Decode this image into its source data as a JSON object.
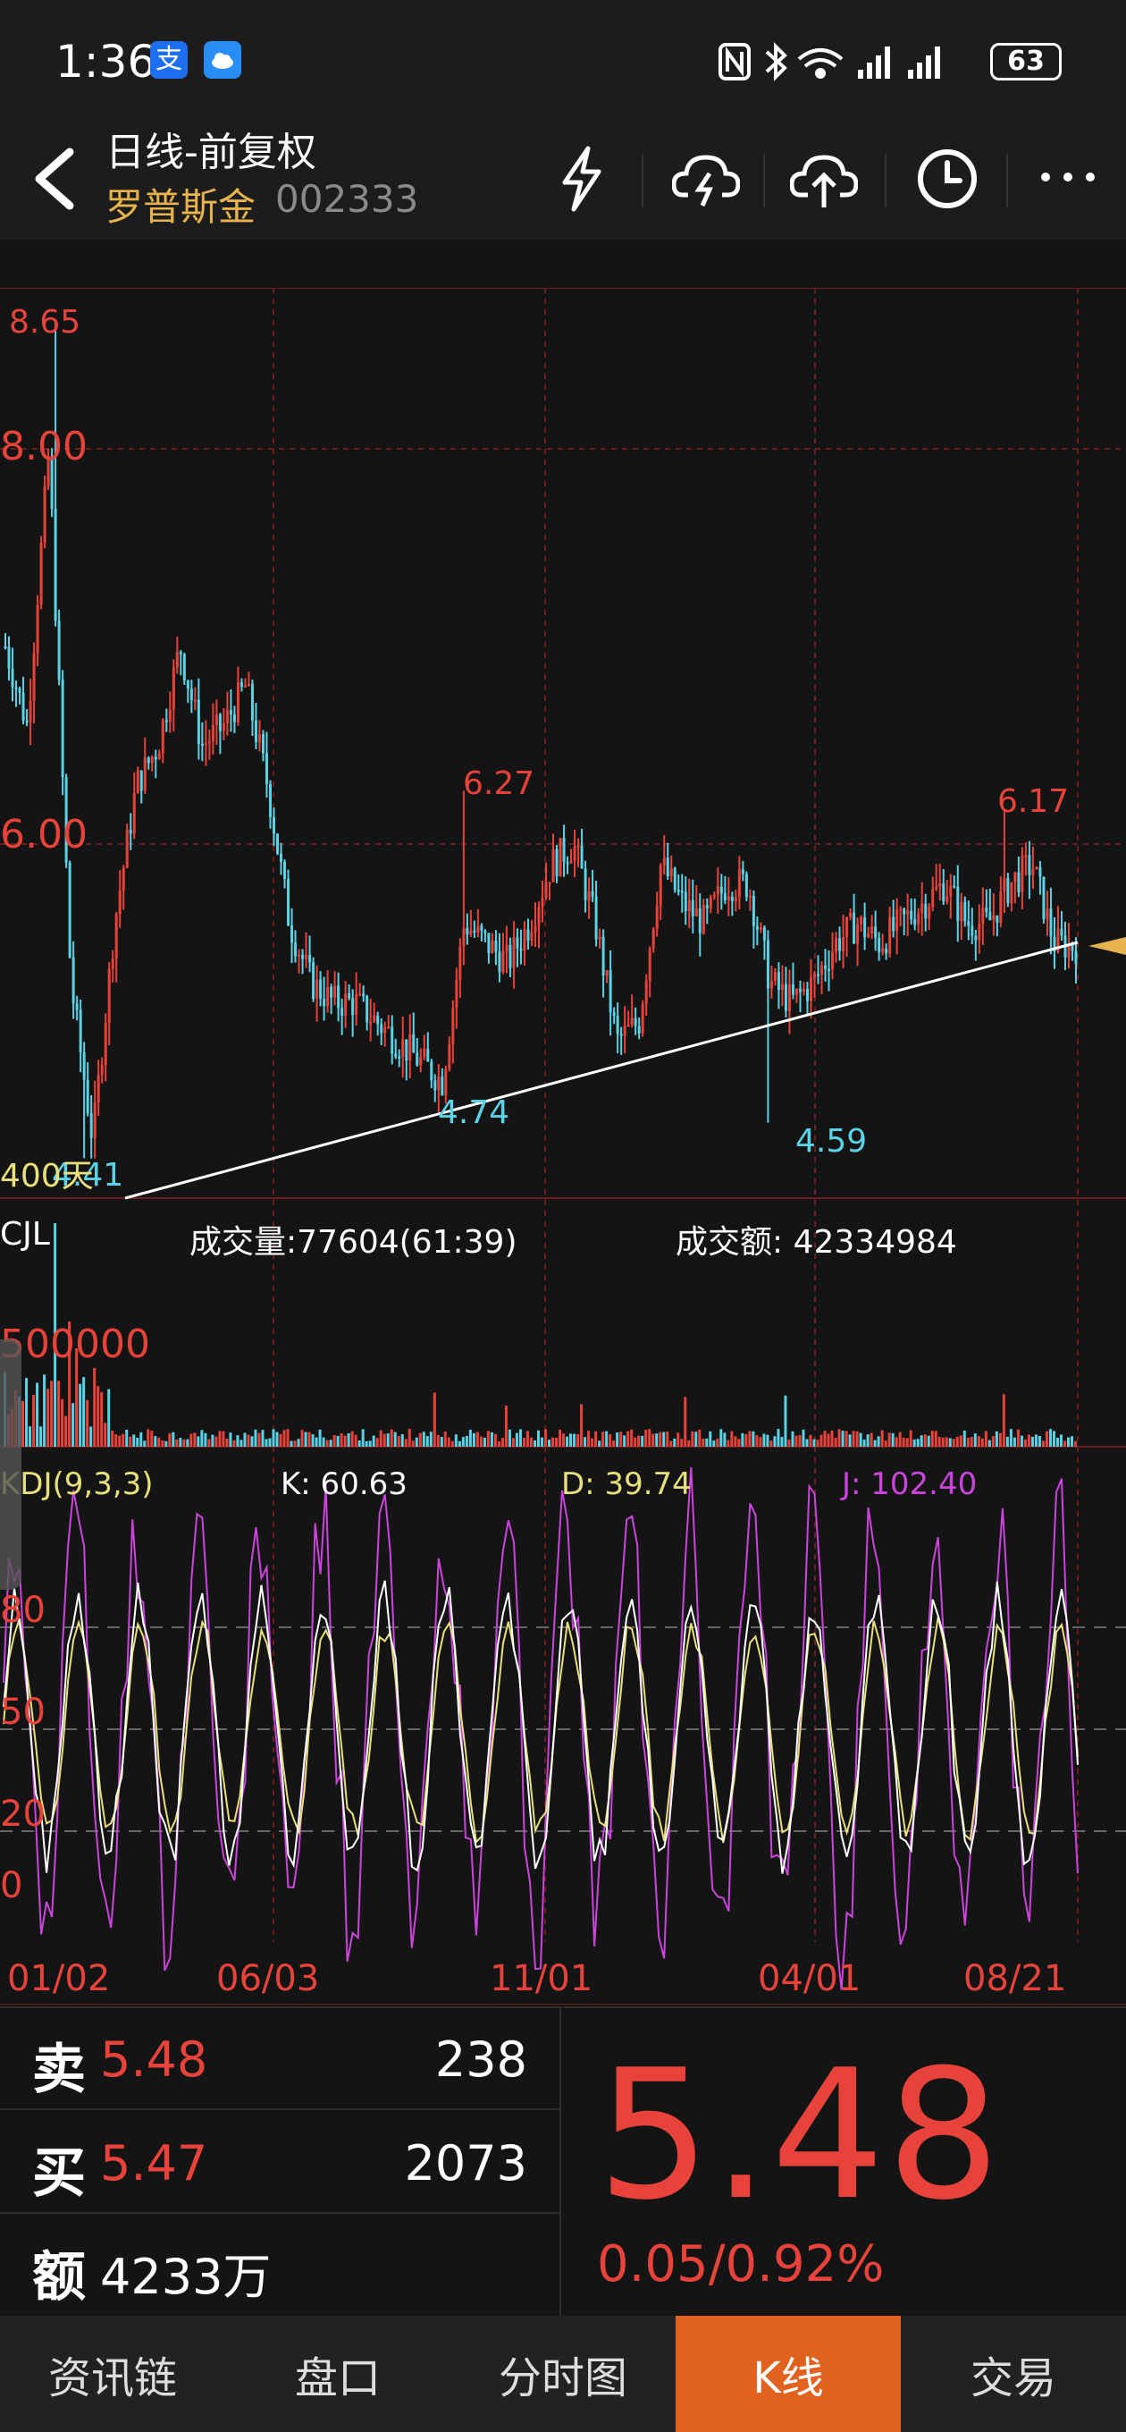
{
  "status_bar": {
    "time": "1:36",
    "battery": "63"
  },
  "header": {
    "title": "日线-前复权",
    "stock_name": "罗普斯金",
    "stock_code": "002333"
  },
  "header_icons": [
    "lightning-icon",
    "cloud-download-icon",
    "cloud-upload-icon",
    "clock-icon",
    "more-icon"
  ],
  "price_chart": {
    "price_axis": [
      "8.00",
      "6.00"
    ],
    "extreme_labels": {
      "high": "8.65",
      "peak_mid": "6.27",
      "peak_right": "6.17",
      "low_left": "4.41",
      "low_mid": "4.74",
      "low_right": "4.59"
    },
    "period_label": "400天"
  },
  "volume": {
    "title": "CJL",
    "volume_text": "成交量:77604(61:39)",
    "amount_text": "成交额: 42334984",
    "axis_label": "500000"
  },
  "kdj": {
    "title": "KDJ(9,3,3)",
    "k_text": "K: 60.63",
    "d_text": "D: 39.74",
    "j_text": "J: 102.40",
    "levels": [
      "80",
      "50",
      "20",
      "0"
    ]
  },
  "x_axis": [
    "01/02",
    "06/03",
    "11/01",
    "04/01",
    "08/21"
  ],
  "quote": {
    "sell_label": "卖",
    "sell_price": "5.48",
    "sell_volume": "238",
    "buy_label": "买",
    "buy_price": "5.47",
    "buy_volume": "2073",
    "amount_label": "额",
    "amount_value": "4233万",
    "last_price": "5.48",
    "change": "0.05/0.92%"
  },
  "tabs": [
    {
      "label": "资讯链",
      "active": false
    },
    {
      "label": "盘口",
      "active": false
    },
    {
      "label": "分时图",
      "active": false
    },
    {
      "label": "K线",
      "active": true
    },
    {
      "label": "交易",
      "active": false
    }
  ],
  "colors": {
    "up": "#e8433a",
    "down": "#5bd3e6",
    "gold": "#e7b34c",
    "k_line": "#ffffff",
    "d_line": "#e8e07a",
    "j_line": "#cc44dd",
    "active_tab": "#e0621e"
  },
  "chart_data": {
    "type": "candlestick",
    "price_labels": {
      "8.65": "max",
      "6.27": "local high",
      "6.17": "local high",
      "4.41": "min",
      "4.74": "local low",
      "4.59": "local low"
    },
    "y_ticks": [
      8.0,
      6.0
    ],
    "x_ticks": [
      "01/02",
      "06/03",
      "11/01",
      "04/01",
      "08/21"
    ],
    "close_series_approx": [
      7.0,
      6.6,
      8.0,
      5.3,
      4.5,
      5.6,
      6.3,
      6.5,
      7.0,
      6.5,
      6.6,
      6.8,
      6.3,
      5.6,
      5.3,
      5.2,
      5.2,
      5.1,
      5.0,
      4.9,
      4.8,
      5.6,
      5.5,
      5.4,
      5.6,
      5.9,
      6.0,
      5.6,
      5.0,
      5.1,
      5.9,
      5.7,
      5.6,
      5.8,
      5.8,
      5.3,
      5.2,
      5.3,
      5.5,
      5.6,
      5.5,
      5.6,
      5.7,
      5.8,
      5.6,
      5.6,
      5.8,
      5.9,
      5.5,
      5.48
    ],
    "volume_axis": 500000,
    "kdj_levels": [
      0,
      20,
      50,
      80
    ],
    "current": {
      "K": 60.63,
      "D": 39.74,
      "J": 102.4
    }
  }
}
